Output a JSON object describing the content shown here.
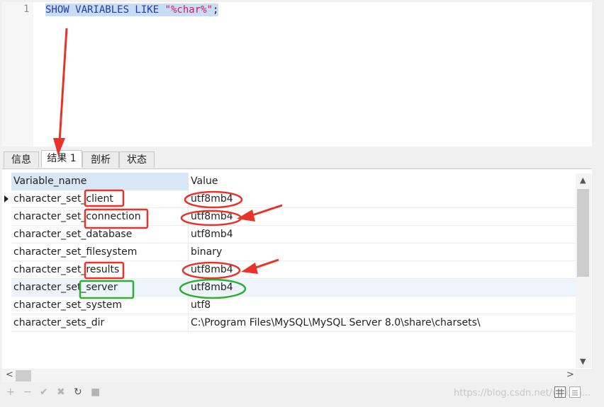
{
  "editor": {
    "line_number": "1",
    "tokens": {
      "keywords": "SHOW VARIABLES LIKE ",
      "string": "\"%char%\"",
      "terminator": ";"
    }
  },
  "tabs": [
    {
      "label": "信息"
    },
    {
      "label": "结果 1"
    },
    {
      "label": "剖析"
    },
    {
      "label": "状态"
    }
  ],
  "result_grid": {
    "columns": [
      "Variable_name",
      "Value"
    ],
    "rows": [
      [
        "character_set_client",
        "utf8mb4"
      ],
      [
        "character_set_connection",
        "utf8mb4"
      ],
      [
        "character_set_database",
        "utf8mb4"
      ],
      [
        "character_set_filesystem",
        "binary"
      ],
      [
        "character_set_results",
        "utf8mb4"
      ],
      [
        "character_set_server",
        "utf8mb4"
      ],
      [
        "character_set_system",
        "utf8"
      ],
      [
        "character_sets_dir",
        "C:\\Program Files\\MySQL\\MySQL Server 8.0\\share\\charsets\\"
      ]
    ]
  },
  "toolbar": {
    "add": "+",
    "remove": "−",
    "apply": "✔",
    "discard": "✖",
    "refresh": "↻",
    "stop": "■"
  },
  "watermark": "https://blog.csdn.net/weixin...",
  "colors": {
    "annotation_red": "#e8322a",
    "annotation_green": "#2eae33",
    "selection": "#c8dcf6"
  },
  "icons": [
    "row-indicator-icon",
    "scroll-up-icon",
    "scroll-down-icon",
    "scroll-left-icon",
    "scroll-right-icon",
    "grid-view-icon",
    "form-view-icon"
  ]
}
